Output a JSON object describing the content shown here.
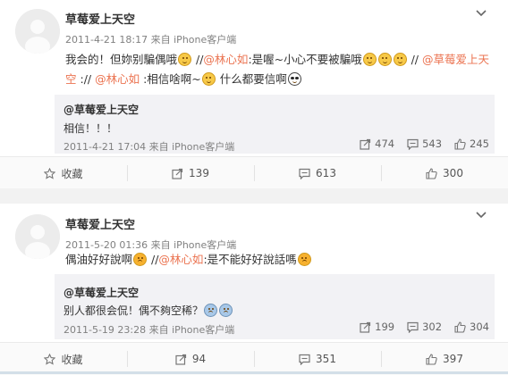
{
  "posts": [
    {
      "username": "草莓爱上天空",
      "time": "2011-4-21 18:17",
      "source_prefix": "来自",
      "source": "iPhone客户端",
      "text_parts": {
        "t1": "我会的！但妳别騙偶哦",
        "t2": " //",
        "m1": "@林心如",
        "t3": ":是喔~小心不要被騙哦",
        "t4": " // ",
        "m2": "@草莓爱上天空",
        "t5": " :// ",
        "m3": "@林心如",
        "t6": " :相信啥啊~",
        "t7": " 什么都要信啊"
      },
      "repost": {
        "username": "@草莓爱上天空",
        "text": "相信！！！",
        "time": "2011-4-21 17:04",
        "source_prefix": "来自",
        "source": "iPhone客户端",
        "forwards": "474",
        "comments": "543",
        "likes": "245"
      },
      "actions": {
        "favorite": "收藏",
        "forward": "139",
        "comment": "613",
        "like": "300"
      }
    },
    {
      "username": "草莓爱上天空",
      "time": "2011-5-20 01:36",
      "source_prefix": "来自",
      "source": "iPhone客户端",
      "text_parts": {
        "t1": "偶油好好說啊",
        "t2": " //",
        "m1": "@林心如",
        "t3": ":是不能好好說話嗎"
      },
      "repost": {
        "username": "@草莓爱上天空",
        "text": "别人都很会侃！偶不夠空稀？",
        "time": "2011-5-19 23:28",
        "source_prefix": "来自",
        "source": "iPhone客户端",
        "forwards": "199",
        "comments": "302",
        "likes": "304"
      },
      "actions": {
        "favorite": "收藏",
        "forward": "94",
        "comment": "351",
        "like": "397"
      }
    }
  ],
  "icons": {
    "avatar": "default-avatar-icon",
    "caret": "chevron-down-icon",
    "forward": "forward-icon",
    "comment": "comment-icon",
    "like": "thumbs-up-icon",
    "favorite": "star-icon"
  },
  "colors": {
    "mention": "#eb7350",
    "meta": "#808080",
    "repost_bg": "#f2f2f5"
  }
}
